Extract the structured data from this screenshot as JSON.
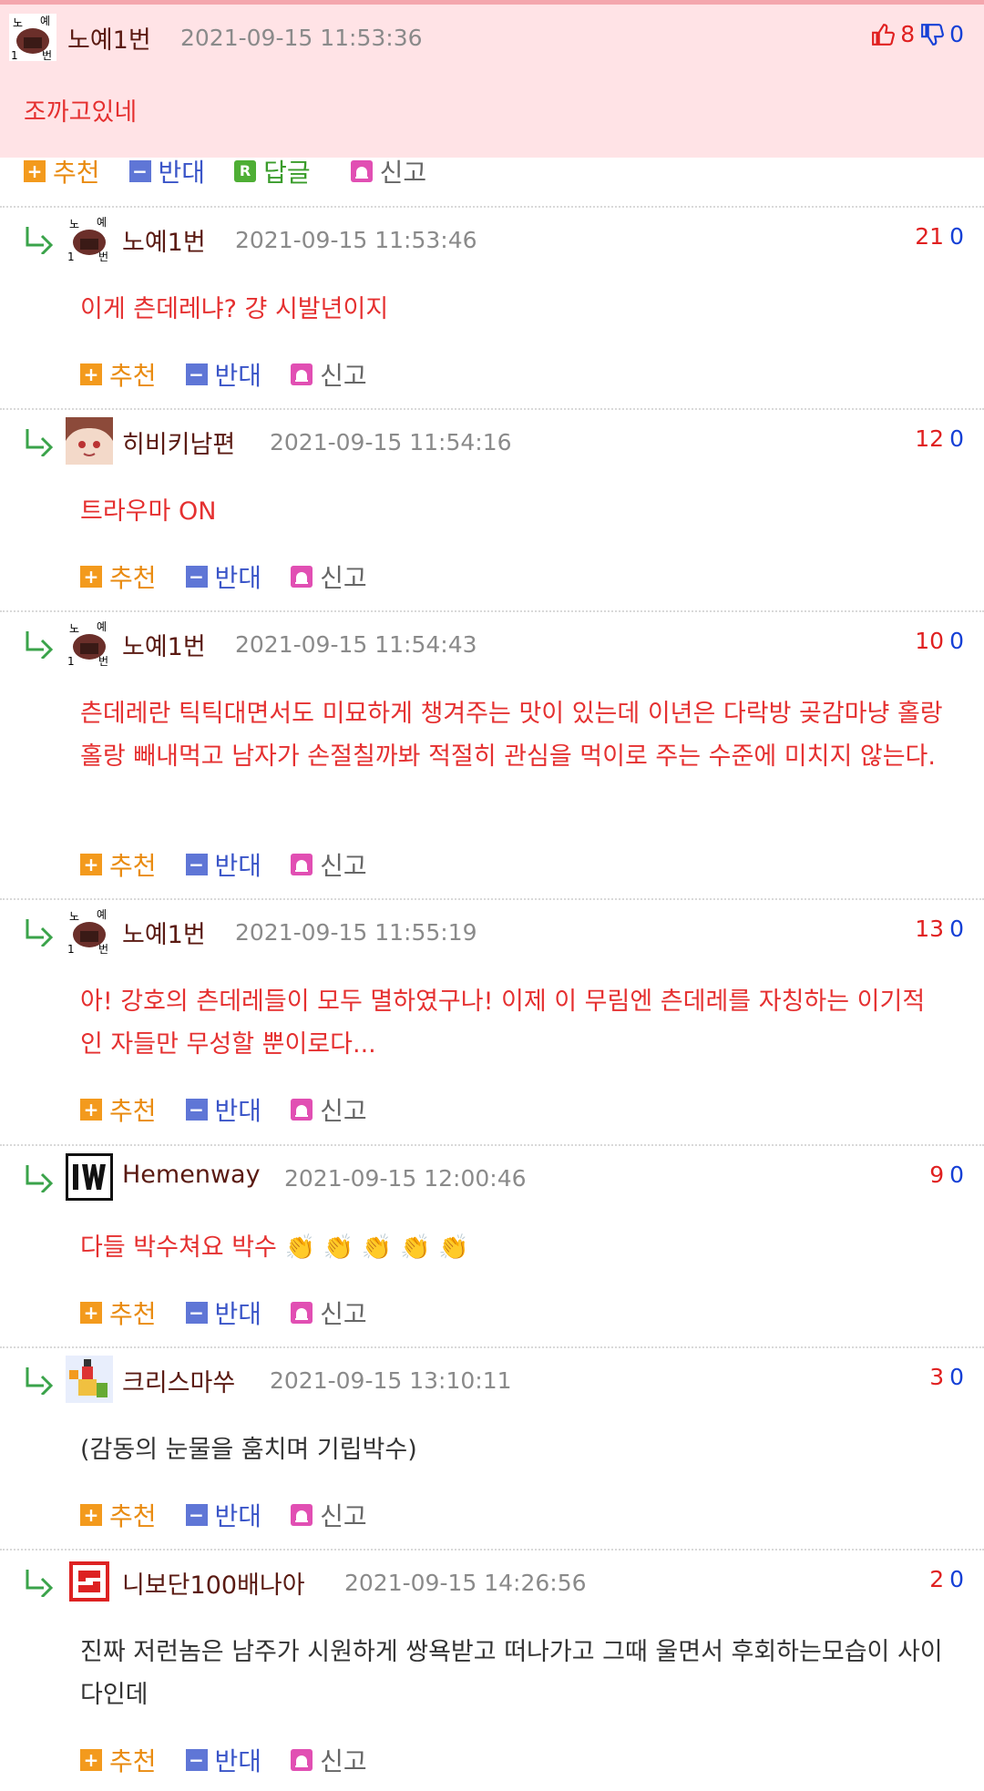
{
  "labels": {
    "recommend": "추천",
    "oppose": "반대",
    "reply": "답글",
    "report": "신고"
  },
  "colors": {
    "accent_up": "#e02020",
    "accent_down": "#1540d6",
    "comment_text": "#e53030",
    "top_bg": "#ffe3e6"
  },
  "comments": [
    {
      "nick": "노예1번",
      "date": "2021-09-15 11:53:36",
      "up": "8",
      "down": "0",
      "text": "조까고있네",
      "avatar": "doll-avatar-icon"
    },
    {
      "nick": "노예1번",
      "date": "2021-09-15 11:53:46",
      "up": "21",
      "down": "0",
      "text": "이게 츤데레냐? 걍 시발년이지",
      "avatar": "doll-avatar-icon"
    },
    {
      "nick": "히비키남편",
      "date": "2021-09-15 11:54:16",
      "up": "12",
      "down": "0",
      "text": "트라우마 ON",
      "avatar": "anime-girl-avatar-icon"
    },
    {
      "nick": "노예1번",
      "date": "2021-09-15 11:54:43",
      "up": "10",
      "down": "0",
      "text": "츤데레란 틱틱대면서도 미묘하게 챙겨주는 맛이 있는데 이년은 다락방 곶감마냥 홀랑홀랑 빼내먹고 남자가 손절칠까봐 적절히 관심을 먹이로 주는 수준에 미치지 않는다.",
      "avatar": "doll-avatar-icon"
    },
    {
      "nick": "노예1번",
      "date": "2021-09-15 11:55:19",
      "up": "13",
      "down": "0",
      "text": "아! 강호의 츤데레들이 모두 멸하였구나! 이제 이 무림엔 츤데레를 자칭하는 이기적인 자들만 무성할 뿐이로다...",
      "avatar": "doll-avatar-icon"
    },
    {
      "nick": "Hemenway",
      "date": "2021-09-15 12:00:46",
      "up": "9",
      "down": "0",
      "text": "다들 박수쳐요 박수 👏 👏 👏 👏 👏",
      "avatar": "w-logo-avatar-icon"
    },
    {
      "nick": "크리스마쑤",
      "date": "2021-09-15 13:10:11",
      "up": "3",
      "down": "0",
      "text": "(감동의 눈물을 훔치며 기립박수)",
      "avatar": "pixel-character-avatar-icon"
    },
    {
      "nick": "니보단100배나아",
      "date": "2021-09-15 14:26:56",
      "up": "2",
      "down": "0",
      "text": "진짜 저런놈은 남주가 시원하게 쌍욕받고 떠나가고 그때 울면서 후회하는모습이 사이다인데",
      "avatar": "red-stamp-avatar-icon"
    }
  ]
}
